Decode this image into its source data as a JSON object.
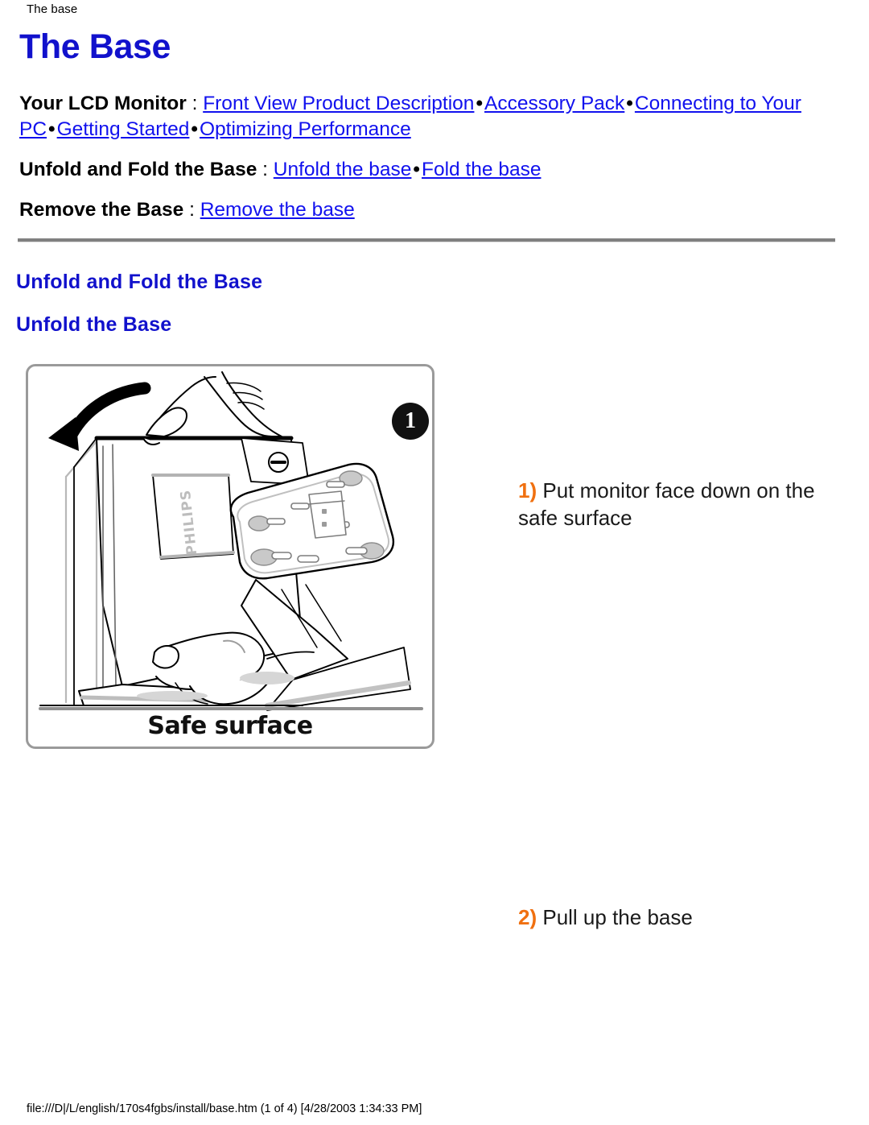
{
  "browser": {
    "header_title": "The base",
    "footer_path": "file:///D|/L/english/170s4fgbs/install/base.htm (1 of 4) [4/28/2003 1:34:33 PM]"
  },
  "page": {
    "title": "The Base",
    "nav": [
      {
        "label": "Your LCD Monitor",
        "colon": " : ",
        "links": [
          "Front View Product Description",
          "Accessory Pack",
          "Connecting to Your PC",
          "Getting Started",
          "Optimizing Performance"
        ],
        "separator": "•"
      },
      {
        "label": "Unfold and Fold the Base",
        "colon": " : ",
        "links": [
          "Unfold the base",
          "Fold the base"
        ],
        "separator": "•"
      },
      {
        "label": "Remove the Base",
        "colon": " : ",
        "links": [
          "Remove the base"
        ],
        "separator": "•"
      }
    ],
    "section_heading": "Unfold and Fold the Base",
    "subsection_heading": "Unfold the Base"
  },
  "figure": {
    "caption": "Safe surface",
    "badge": "1",
    "monitor_brand": "PHILIPS"
  },
  "steps": [
    {
      "num": "1)",
      "text": " Put monitor face down on the safe surface"
    },
    {
      "num": "2)",
      "text": " Pull up the base"
    }
  ],
  "colors": {
    "heading_blue": "#1111cc",
    "link_blue": "#1111ee",
    "step_number_orange": "#f07010",
    "rule_gray": "#808080",
    "figure_border": "#9a9a9a"
  }
}
